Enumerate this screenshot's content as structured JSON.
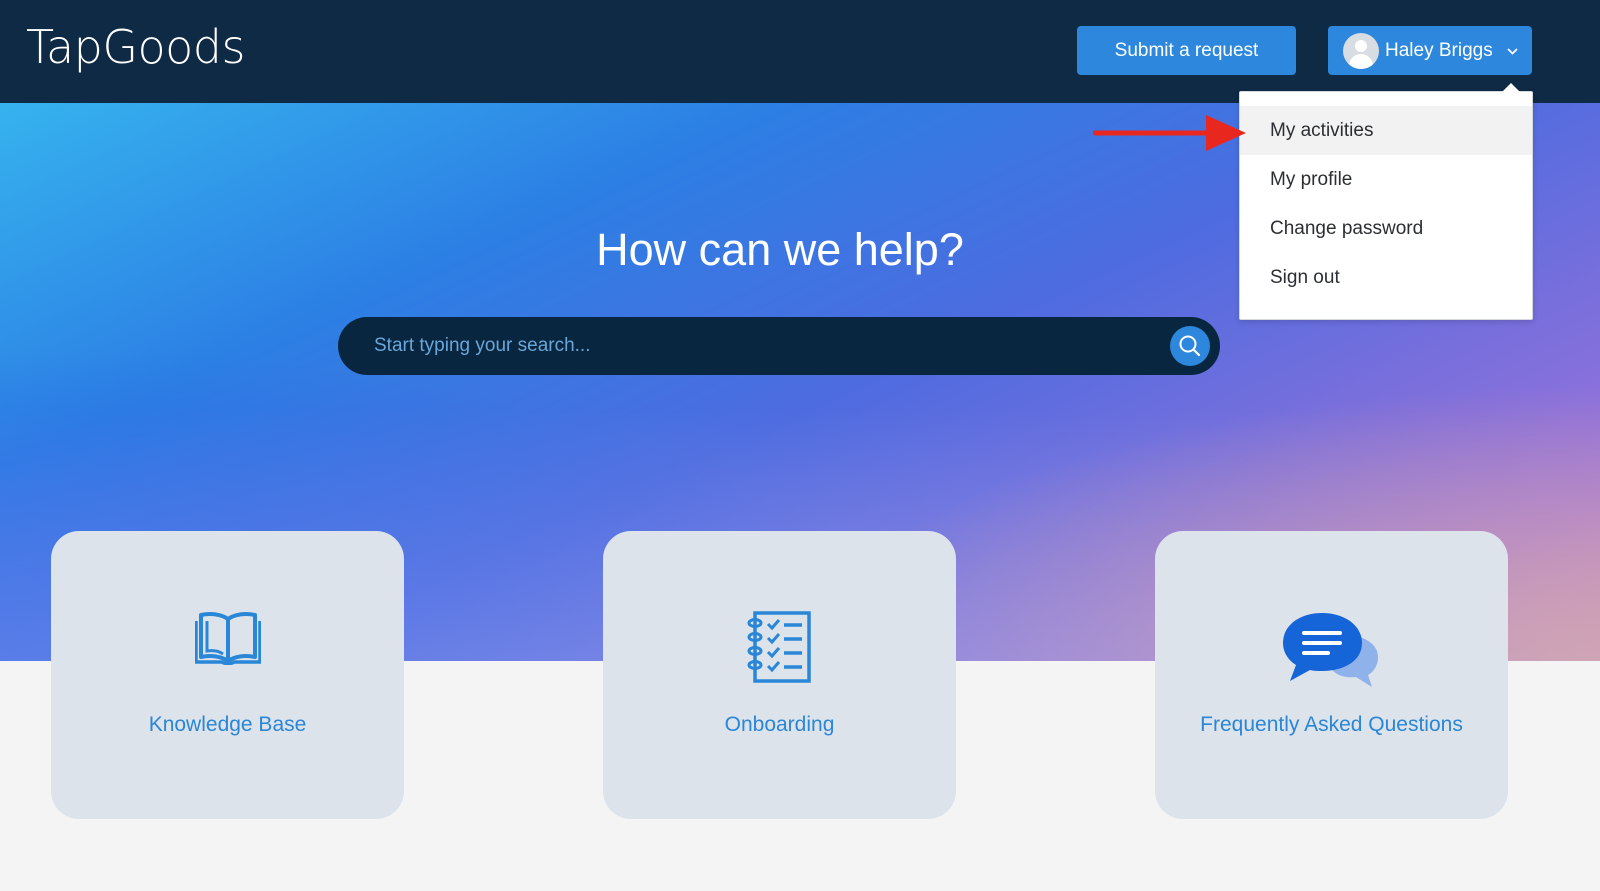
{
  "header": {
    "logo_text": "TapGoods",
    "submit_label": "Submit a request",
    "user_name": "Haley Briggs",
    "avatar_icon": "user-avatar-icon",
    "dropdown_icon": "chevron-down-icon"
  },
  "user_menu": {
    "items": [
      {
        "label": "My activities",
        "highlighted": true
      },
      {
        "label": "My profile"
      },
      {
        "label": "Change password"
      },
      {
        "label": "Sign out"
      }
    ]
  },
  "hero": {
    "title": "How can we help?",
    "search_placeholder": "Start typing your search...",
    "search_icon": "search-icon"
  },
  "categories": [
    {
      "label": "Knowledge Base",
      "icon": "open-book-icon"
    },
    {
      "label": "Onboarding",
      "icon": "checklist-icon"
    },
    {
      "label": "Frequently Asked Questions",
      "icon": "chat-bubbles-icon"
    }
  ],
  "annotation": {
    "icon": "red-arrow-icon",
    "color": "#e8281e"
  },
  "colors": {
    "header_bg": "#0f2a44",
    "button_blue": "#2d87dc",
    "search_bg": "#08263f",
    "card_bg": "#dde3ea",
    "link_blue": "#2a86d6"
  }
}
